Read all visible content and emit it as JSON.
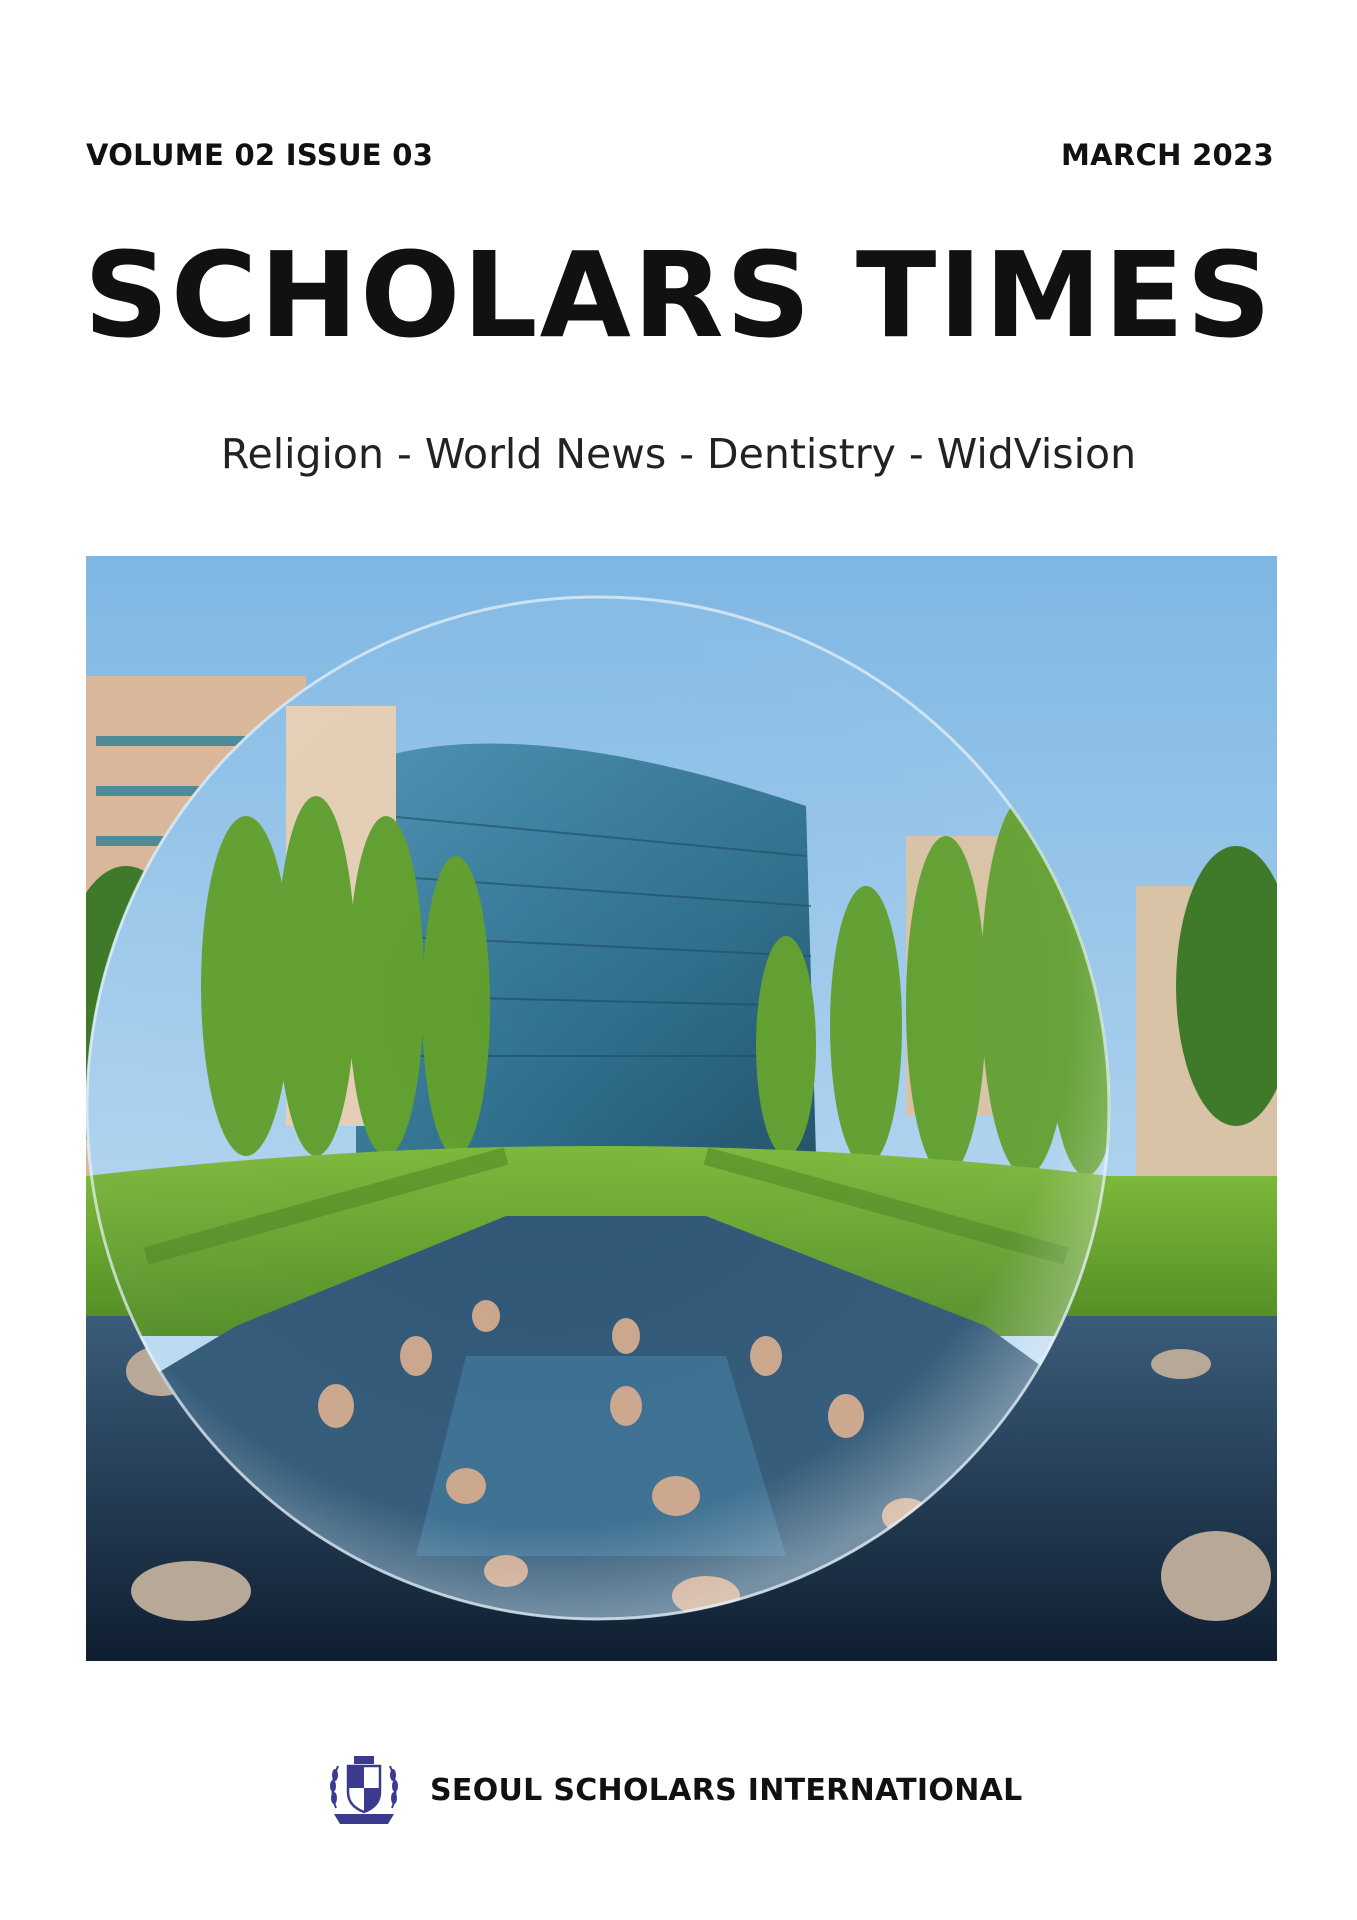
{
  "header": {
    "volume_issue": "VOLUME 02 ISSUE 03",
    "date": "MARCH 2023"
  },
  "masthead": {
    "title": "SCHOLARS TIMES",
    "sections_line": "Religion - World News - Dentistry - WidVision"
  },
  "cover_image": {
    "description_icon": "glass-sphere-campus-photo"
  },
  "footer": {
    "organization": "SEOUL SCHOLARS INTERNATIONAL",
    "logo_icon": "crest-icon"
  },
  "colors": {
    "text": "#111111",
    "sky": "#8fc4e8",
    "grass": "#6aa62c",
    "water": "#1e3550",
    "crest": "#3b3a8f"
  }
}
